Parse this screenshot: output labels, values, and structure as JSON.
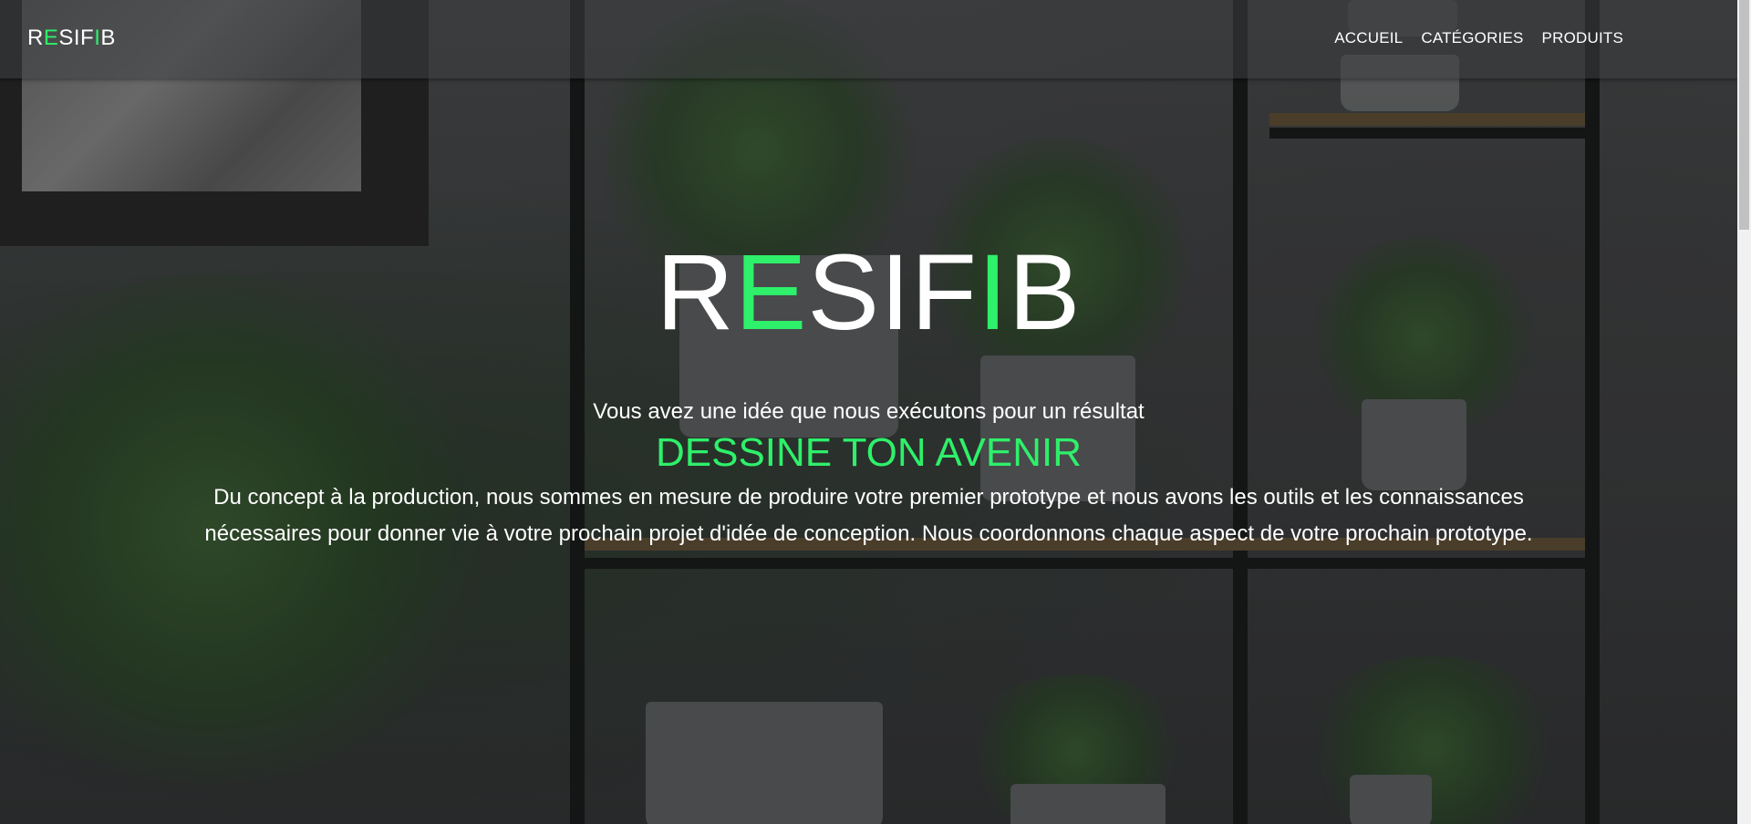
{
  "brand": {
    "letters": [
      "R",
      "E",
      "SIF",
      "I",
      "B"
    ]
  },
  "nav": {
    "items": [
      {
        "label": "ACCUEIL"
      },
      {
        "label": "CATÉGORIES"
      },
      {
        "label": "PRODUITS"
      }
    ]
  },
  "hero": {
    "title_letters": [
      "R",
      "E",
      "SIF",
      "I",
      "B"
    ],
    "subtitle": "Vous avez une idée que nous exécutons pour un résultat",
    "tagline": "DESSINE TON AVENIR",
    "description": "Du concept à la production, nous sommes en mesure de produire votre premier prototype et nous avons les outils et les connaissances nécessaires pour donner vie à votre prochain projet d'idée de conception. Nous coordonnons chaque aspect de votre prochain prototype."
  },
  "colors": {
    "accent": "#2ef06a",
    "text": "#ffffff",
    "header_bg": "#3c3e40"
  }
}
